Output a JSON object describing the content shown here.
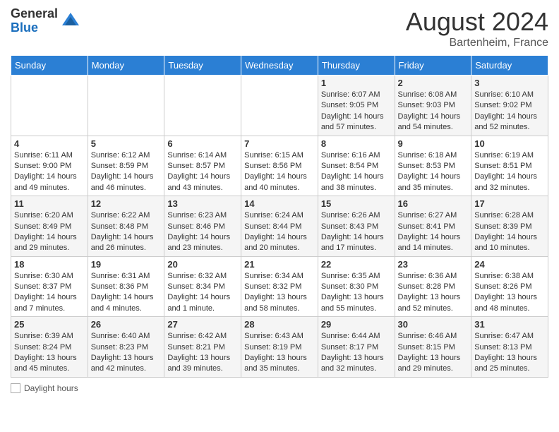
{
  "header": {
    "logo_general": "General",
    "logo_blue": "Blue",
    "month_year": "August 2024",
    "location": "Bartenheim, France"
  },
  "days_of_week": [
    "Sunday",
    "Monday",
    "Tuesday",
    "Wednesday",
    "Thursday",
    "Friday",
    "Saturday"
  ],
  "weeks": [
    [
      {
        "day": "",
        "info": ""
      },
      {
        "day": "",
        "info": ""
      },
      {
        "day": "",
        "info": ""
      },
      {
        "day": "",
        "info": ""
      },
      {
        "day": "1",
        "info": "Sunrise: 6:07 AM\nSunset: 9:05 PM\nDaylight: 14 hours and 57 minutes."
      },
      {
        "day": "2",
        "info": "Sunrise: 6:08 AM\nSunset: 9:03 PM\nDaylight: 14 hours and 54 minutes."
      },
      {
        "day": "3",
        "info": "Sunrise: 6:10 AM\nSunset: 9:02 PM\nDaylight: 14 hours and 52 minutes."
      }
    ],
    [
      {
        "day": "4",
        "info": "Sunrise: 6:11 AM\nSunset: 9:00 PM\nDaylight: 14 hours and 49 minutes."
      },
      {
        "day": "5",
        "info": "Sunrise: 6:12 AM\nSunset: 8:59 PM\nDaylight: 14 hours and 46 minutes."
      },
      {
        "day": "6",
        "info": "Sunrise: 6:14 AM\nSunset: 8:57 PM\nDaylight: 14 hours and 43 minutes."
      },
      {
        "day": "7",
        "info": "Sunrise: 6:15 AM\nSunset: 8:56 PM\nDaylight: 14 hours and 40 minutes."
      },
      {
        "day": "8",
        "info": "Sunrise: 6:16 AM\nSunset: 8:54 PM\nDaylight: 14 hours and 38 minutes."
      },
      {
        "day": "9",
        "info": "Sunrise: 6:18 AM\nSunset: 8:53 PM\nDaylight: 14 hours and 35 minutes."
      },
      {
        "day": "10",
        "info": "Sunrise: 6:19 AM\nSunset: 8:51 PM\nDaylight: 14 hours and 32 minutes."
      }
    ],
    [
      {
        "day": "11",
        "info": "Sunrise: 6:20 AM\nSunset: 8:49 PM\nDaylight: 14 hours and 29 minutes."
      },
      {
        "day": "12",
        "info": "Sunrise: 6:22 AM\nSunset: 8:48 PM\nDaylight: 14 hours and 26 minutes."
      },
      {
        "day": "13",
        "info": "Sunrise: 6:23 AM\nSunset: 8:46 PM\nDaylight: 14 hours and 23 minutes."
      },
      {
        "day": "14",
        "info": "Sunrise: 6:24 AM\nSunset: 8:44 PM\nDaylight: 14 hours and 20 minutes."
      },
      {
        "day": "15",
        "info": "Sunrise: 6:26 AM\nSunset: 8:43 PM\nDaylight: 14 hours and 17 minutes."
      },
      {
        "day": "16",
        "info": "Sunrise: 6:27 AM\nSunset: 8:41 PM\nDaylight: 14 hours and 14 minutes."
      },
      {
        "day": "17",
        "info": "Sunrise: 6:28 AM\nSunset: 8:39 PM\nDaylight: 14 hours and 10 minutes."
      }
    ],
    [
      {
        "day": "18",
        "info": "Sunrise: 6:30 AM\nSunset: 8:37 PM\nDaylight: 14 hours and 7 minutes."
      },
      {
        "day": "19",
        "info": "Sunrise: 6:31 AM\nSunset: 8:36 PM\nDaylight: 14 hours and 4 minutes."
      },
      {
        "day": "20",
        "info": "Sunrise: 6:32 AM\nSunset: 8:34 PM\nDaylight: 14 hours and 1 minute."
      },
      {
        "day": "21",
        "info": "Sunrise: 6:34 AM\nSunset: 8:32 PM\nDaylight: 13 hours and 58 minutes."
      },
      {
        "day": "22",
        "info": "Sunrise: 6:35 AM\nSunset: 8:30 PM\nDaylight: 13 hours and 55 minutes."
      },
      {
        "day": "23",
        "info": "Sunrise: 6:36 AM\nSunset: 8:28 PM\nDaylight: 13 hours and 52 minutes."
      },
      {
        "day": "24",
        "info": "Sunrise: 6:38 AM\nSunset: 8:26 PM\nDaylight: 13 hours and 48 minutes."
      }
    ],
    [
      {
        "day": "25",
        "info": "Sunrise: 6:39 AM\nSunset: 8:24 PM\nDaylight: 13 hours and 45 minutes."
      },
      {
        "day": "26",
        "info": "Sunrise: 6:40 AM\nSunset: 8:23 PM\nDaylight: 13 hours and 42 minutes."
      },
      {
        "day": "27",
        "info": "Sunrise: 6:42 AM\nSunset: 8:21 PM\nDaylight: 13 hours and 39 minutes."
      },
      {
        "day": "28",
        "info": "Sunrise: 6:43 AM\nSunset: 8:19 PM\nDaylight: 13 hours and 35 minutes."
      },
      {
        "day": "29",
        "info": "Sunrise: 6:44 AM\nSunset: 8:17 PM\nDaylight: 13 hours and 32 minutes."
      },
      {
        "day": "30",
        "info": "Sunrise: 6:46 AM\nSunset: 8:15 PM\nDaylight: 13 hours and 29 minutes."
      },
      {
        "day": "31",
        "info": "Sunrise: 6:47 AM\nSunset: 8:13 PM\nDaylight: 13 hours and 25 minutes."
      }
    ]
  ],
  "footer": {
    "label": "Daylight hours"
  }
}
